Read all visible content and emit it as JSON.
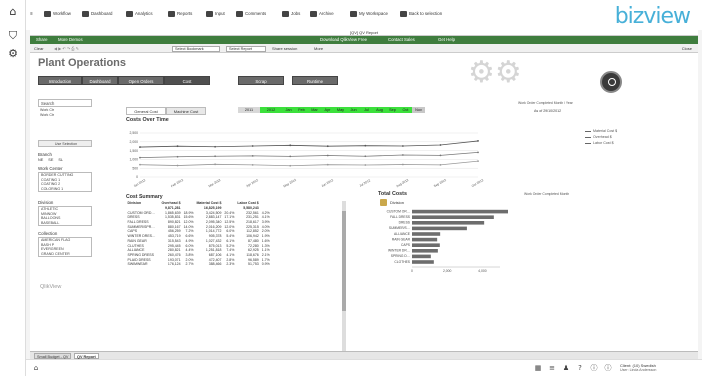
{
  "rail": {
    "menu_icon": "≡",
    "filter_icon": "funnel-icon",
    "settings_icon": "⚙"
  },
  "nav": {
    "workflow": "Workflow",
    "dashboard": "Dashboard",
    "analytics": "Analytics",
    "reports": "Reports",
    "input": "Input",
    "comments": "Comments",
    "jobs": "Jobs",
    "archive": "Archive",
    "my_workspace": "My Workspace",
    "back": "Back to selection",
    "logo": "bizview"
  },
  "window": {
    "title": "[QV] QV Report",
    "share": "Share",
    "more_demos": "More Demos",
    "download": "Download QlikView Free",
    "contact": "Contact Sales",
    "get_help": "Get Help"
  },
  "toolbar": {
    "clear": "Clear",
    "select_bookmark": "Select Bookmark",
    "select_report": "Select Report",
    "share_session": "Share session",
    "more": "More",
    "close": "Close"
  },
  "page": {
    "title": "Plant Operations",
    "tabs": [
      "Introduction",
      "Dashboard",
      "Open Orders",
      "Cost",
      "Scrap",
      "Runtime"
    ],
    "active_tab": "Cost",
    "as_of": "As of 29/10/2012"
  },
  "left_panel": {
    "search": "Search",
    "search_items": [
      "Work Ctr",
      "Work Ctr"
    ],
    "use_selection": "Use Selection",
    "branch_label": "Branch",
    "branch_options": [
      "NE",
      "SE",
      "SL"
    ],
    "work_center_label": "Work Center",
    "work_center_items": [
      "BORDER CUTTING",
      "COATING 1",
      "COATING 2",
      "COLORING 1"
    ],
    "division_label": "Division",
    "division_items": [
      "ATHLETIC",
      "MINNOW",
      "BALLOONS",
      "BASEBALL"
    ],
    "collection_label": "Collection",
    "collection_items": [
      "AMERICAN FLAG",
      "BASH P",
      "EVERGREEN",
      "GRAND CENTER"
    ],
    "logo": "QlikView"
  },
  "chart_tabs": [
    "General Cost",
    "Machine Cost"
  ],
  "months": [
    "2011",
    "2012",
    "Jan",
    "Feb",
    "Mar",
    "Apr",
    "May",
    "Jun",
    "Jul",
    "Aug",
    "Sep",
    "Oct",
    "Nov"
  ],
  "months_caption": "Work Order Completed Month / Year",
  "chart_data": {
    "type": "line",
    "title": "Costs Over Time",
    "xlabel": "Work Order Completed Month",
    "ylabel": "",
    "x": [
      "Jan 2012",
      "Feb 2012",
      "Mar 2012",
      "Apr 2012",
      "May 2012",
      "Jun 2012",
      "Jul 2012",
      "Aug 2012",
      "Sep 2012",
      "Oct 2012"
    ],
    "ylim": [
      0,
      2500
    ],
    "yticks": [
      "0",
      "500",
      "1,000",
      "1,500",
      "2,000",
      "2,500"
    ],
    "series": [
      {
        "name": "Material Cost $",
        "values": [
          1700,
          1750,
          1720,
          1760,
          1800,
          1750,
          1780,
          1760,
          1820,
          2050
        ]
      },
      {
        "name": "Overhead $",
        "values": [
          1100,
          1150,
          1180,
          1200,
          1170,
          1220,
          1180,
          1250,
          1230,
          1400
        ]
      },
      {
        "name": "Labor Cost $",
        "values": [
          700,
          650,
          720,
          690,
          640,
          700,
          680,
          710,
          690,
          900
        ]
      }
    ],
    "grid": true,
    "legend": "right"
  },
  "cost_summary": {
    "title": "Cost Summary",
    "headers": [
      "Division",
      "Overhead $",
      "",
      "Material Cost $",
      "",
      "Labor Cost $",
      ""
    ],
    "total": [
      "",
      "9,871,281",
      "",
      "16,825,199",
      "",
      "5,580,243",
      ""
    ],
    "rows": [
      [
        "CUSTOM ORD…",
        "1,865,639",
        "18.9%",
        "3,424,509",
        "20.4%",
        "232,561",
        "4.2%"
      ],
      [
        "DRESS",
        "1,535,831",
        "15.6%",
        "2,883,147",
        "17.1%",
        "231,251",
        "4.1%"
      ],
      [
        "FALL DRESS",
        "890,821",
        "12.0%",
        "2,095,340",
        "12.5%",
        "218,617",
        "3.9%"
      ],
      [
        "SUMMER/SPR…",
        "880,167",
        "14.0%",
        "2,016,209",
        "12.0%",
        "225,315",
        "4.0%"
      ],
      [
        "CAPS",
        "456,259",
        "7.2%",
        "1,014,772",
        "6.0%",
        "112,852",
        "2.0%"
      ],
      [
        "WINTER DRES…",
        "453,719",
        "6.6%",
        "905,378",
        "5.4%",
        "106,942",
        "1.9%"
      ],
      [
        "RAIN GEAR",
        "315,543",
        "4.9%",
        "1,027,432",
        "6.1%",
        "87,480",
        "1.6%"
      ],
      [
        "CLUTHES",
        "295,445",
        "6.0%",
        "875,013",
        "5.2%",
        "72,280",
        "1.3%"
      ],
      [
        "ALLIANCE",
        "280,821",
        "4.4%",
        "1,251,818",
        "7.4%",
        "62,925",
        "1.1%"
      ],
      [
        "SPRING DRESS",
        "260,476",
        "3.8%",
        "687,106",
        "4.1%",
        "118,676",
        "2.1%"
      ],
      [
        "PLAID DRESS",
        "193,071",
        "2.0%",
        "472,407",
        "2.8%",
        "96,589",
        "1.7%"
      ],
      [
        "SWIMWEAR",
        "176,124",
        "2.7%",
        "388,466",
        "2.3%",
        "51,753",
        "0.9%"
      ]
    ]
  },
  "total_costs": {
    "title": "Total Costs",
    "dimension": "Division",
    "categories": [
      "CUSTOM OR…",
      "FALL DRESS",
      "DRESS",
      "SUMMER/S…",
      "ALLIANCE",
      "RAIN GEAR",
      "CAPS",
      "WINTER DR…",
      "SPRING D…",
      "CLOTHES"
    ],
    "values": [
      5520,
      4650,
      4100,
      3120,
      1600,
      1430,
      1580,
      1470,
      1070,
      1240
    ],
    "xlim": [
      0,
      5000
    ],
    "xticks": [
      "0",
      "2,000",
      "4,000"
    ]
  },
  "bottom_tabs": [
    "Small Budget - QV",
    "QV Report"
  ],
  "footer": {
    "client": "Client: (10) Swedish",
    "user": "User: Linda Andersson"
  }
}
